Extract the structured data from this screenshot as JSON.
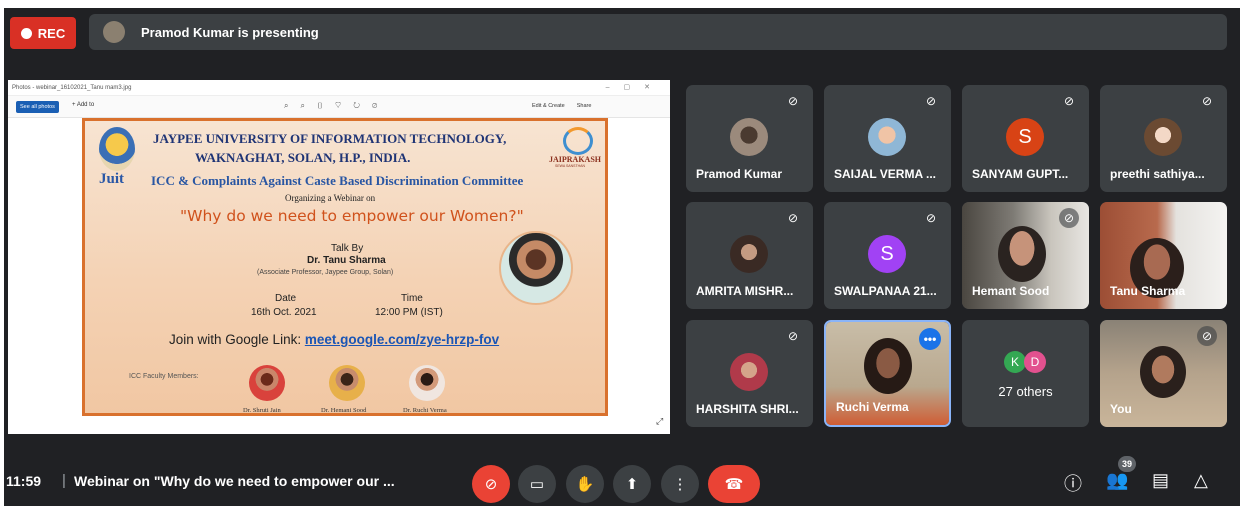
{
  "recording": {
    "label": "REC"
  },
  "presenter": {
    "text": "Pramod Kumar is presenting"
  },
  "presentation": {
    "window_title": "Photos - webinar_16102021_Tanu mam3.jpg",
    "toolbar": {
      "see_all": "See all photos",
      "add_to": "+ Add to",
      "edit": "Edit & Create",
      "share": "Share"
    },
    "poster": {
      "title_line1": "JAYPEE UNIVERSITY OF INFORMATION TECHNOLOGY,",
      "title_line2": "WAKNAGHAT, SOLAN, H.P., INDIA.",
      "logo_text": "Juit",
      "right_logo": "JAIPRAKASH",
      "right_logo_sub": "SEWA SANSTHAN",
      "committee": "ICC & Complaints Against Caste Based Discrimination Committee",
      "organizing": "Organizing a Webinar on",
      "topic": "\"Why do we need to empower our Women?\"",
      "talk_by": "Talk By",
      "speaker": "Dr. Tanu Sharma",
      "speaker_role": "(Associate Professor, Jaypee Group, Solan)",
      "date_label": "Date",
      "date_value": "16th Oct. 2021",
      "time_label": "Time",
      "time_value": "12:00 PM (IST)",
      "join_text": "Join with Google Link: ",
      "join_link": "meet.google.com/zye-hrzp-fov",
      "faculty_label": "ICC Faculty Members:",
      "faculty": [
        "Dr. Shruti Jain",
        "Dr. Hemani Sood",
        "Dr. Ruchi Verma"
      ]
    }
  },
  "participants": [
    {
      "name": "Pramod Kumar",
      "muted": true
    },
    {
      "name": "SAIJAL VERMA ...",
      "muted": true
    },
    {
      "name": "SANYAM GUPT...",
      "muted": true,
      "letter": "S",
      "color": "#d84315"
    },
    {
      "name": "preethi sathiya...",
      "muted": true
    },
    {
      "name": "AMRITA MISHR...",
      "muted": true
    },
    {
      "name": "SWALPANAA 21...",
      "muted": true,
      "letter": "S",
      "color": "#a142f4"
    },
    {
      "name": "Hemant Sood",
      "muted": true
    },
    {
      "name": "Tanu Sharma",
      "muted": false
    },
    {
      "name": "HARSHITA SHRI...",
      "muted": true
    },
    {
      "name": "Ruchi Verma",
      "muted": false
    },
    {
      "name": "You",
      "muted": true
    }
  ],
  "others": {
    "k": "K",
    "d": "D",
    "label": "27 others"
  },
  "bottom": {
    "time": "11:59",
    "separator": "|",
    "meeting_title": "Webinar on \"Why do we need to empower our ...",
    "people_count": "39"
  },
  "colors": {
    "accent": "#1a73e8",
    "danger": "#ea4335",
    "tile": "#3c4043",
    "bg": "#202124"
  }
}
